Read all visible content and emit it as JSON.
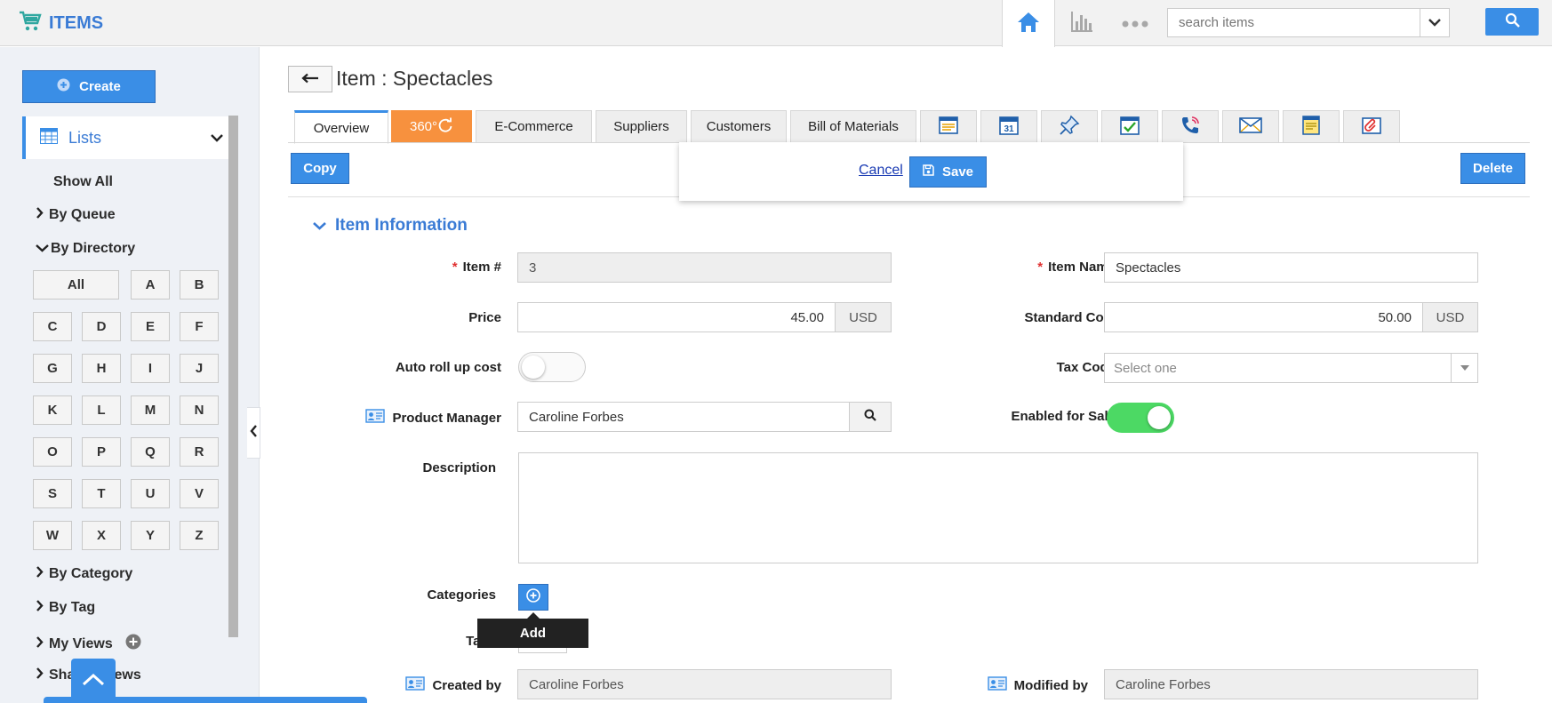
{
  "app": {
    "title": "ITEMS"
  },
  "search": {
    "placeholder": "search items"
  },
  "sidebar": {
    "create_label": "Create",
    "lists_label": "Lists",
    "show_all": "Show All",
    "by_queue": "By Queue",
    "by_directory": "By Directory",
    "letters": [
      "All",
      "A",
      "B",
      "C",
      "D",
      "E",
      "F",
      "G",
      "H",
      "I",
      "J",
      "K",
      "L",
      "M",
      "N",
      "O",
      "P",
      "Q",
      "R",
      "S",
      "T",
      "U",
      "V",
      "W",
      "X",
      "Y",
      "Z"
    ],
    "by_category": "By Category",
    "by_tag": "By Tag",
    "my_views": "My Views",
    "shared_views": "Shared Views"
  },
  "header": {
    "title": "Item : Spectacles"
  },
  "tabs": [
    {
      "label": "Overview"
    },
    {
      "label": "360°"
    },
    {
      "label": "E-Commerce"
    },
    {
      "label": "Suppliers"
    },
    {
      "label": "Customers"
    },
    {
      "label": "Bill of Materials"
    }
  ],
  "tab_icons": [
    "form-icon",
    "calendar-icon",
    "pin-icon",
    "task-icon",
    "call-icon",
    "mail-icon",
    "note-icon",
    "attachment-icon"
  ],
  "calendar_day": "31",
  "actions": {
    "copy": "Copy",
    "delete": "Delete",
    "cancel": "Cancel",
    "save": "Save"
  },
  "section": {
    "title": "Item Information"
  },
  "form": {
    "item_no": {
      "label": "Item #",
      "value": "3"
    },
    "item_name": {
      "label": "Item Name",
      "value": "Spectacles"
    },
    "price": {
      "label": "Price",
      "value": "45.00",
      "currency": "USD"
    },
    "standard_cost": {
      "label": "Standard Cost",
      "value": "50.00",
      "currency": "USD"
    },
    "auto_roll_up": {
      "label": "Auto roll up cost",
      "on": false
    },
    "tax_code": {
      "label": "Tax Code",
      "placeholder": "Select one"
    },
    "product_manager": {
      "label": "Product Manager",
      "value": "Caroline Forbes"
    },
    "enabled_for_sale": {
      "label": "Enabled for Sale",
      "on": true
    },
    "description": {
      "label": "Description",
      "value": ""
    },
    "categories": {
      "label": "Categories"
    },
    "tags": {
      "label": "Tags"
    },
    "created_by": {
      "label": "Created by",
      "value": "Caroline Forbes"
    },
    "modified_by": {
      "label": "Modified by",
      "value": "Caroline Forbes"
    }
  },
  "tooltip": {
    "text": "Add"
  },
  "colors": {
    "accent": "#3a8ee6",
    "orange": "#f7913e",
    "toggle_on": "#4cd964"
  }
}
